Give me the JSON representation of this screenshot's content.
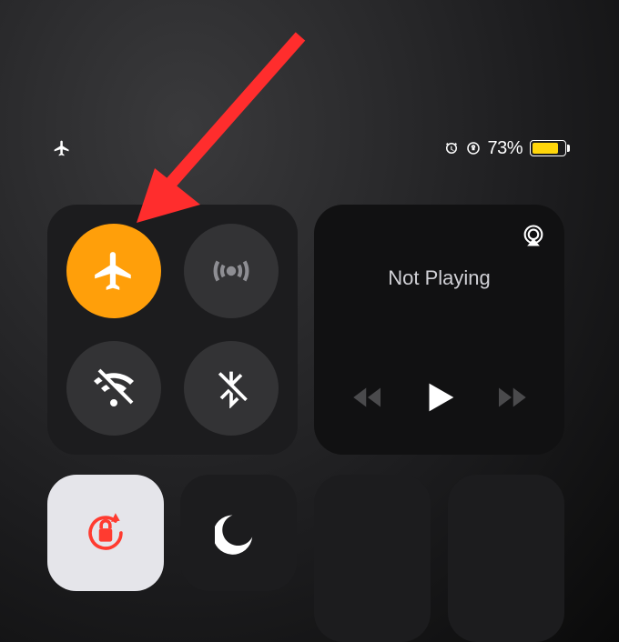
{
  "status": {
    "airplane_mode_indicator": "airplane",
    "alarm_set": true,
    "orientation_locked": true,
    "battery_percent": "73%",
    "battery_color": "#ffd60a"
  },
  "connectivity": {
    "airplane": {
      "name": "airplane-mode",
      "active": true
    },
    "cellular": {
      "name": "cellular-data",
      "active": false
    },
    "wifi": {
      "name": "wifi",
      "active": false,
      "state": "off"
    },
    "bluetooth": {
      "name": "bluetooth",
      "active": false,
      "state": "off"
    }
  },
  "media": {
    "title": "Not Playing",
    "airplay": "airplay"
  },
  "tiles": {
    "orientation_lock": {
      "active": true
    },
    "dnd": {
      "active": false
    }
  },
  "annotation": {
    "arrow_color": "#ff3b30"
  }
}
